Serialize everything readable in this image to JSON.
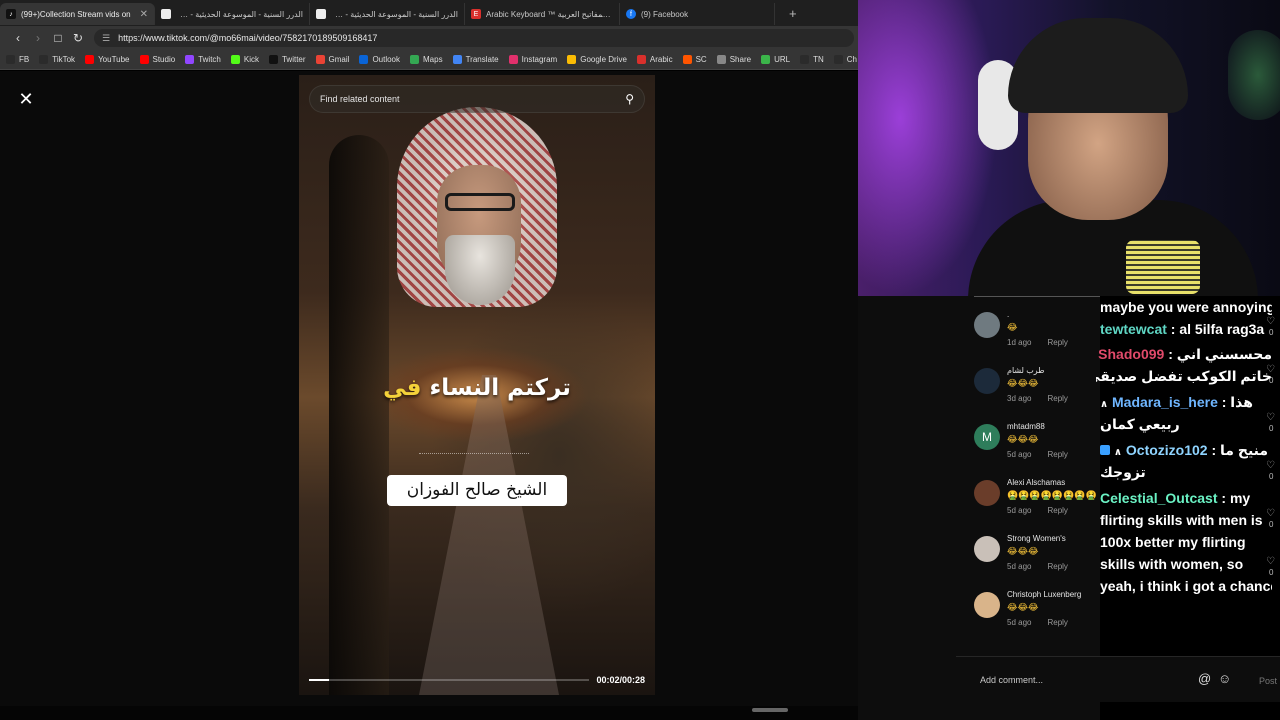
{
  "browser": {
    "tabs": [
      {
        "label": "(99+)Collection Stream vids on",
        "favicon": "tiktok-icon",
        "active": true
      },
      {
        "label": "الدرر السنية - الموسوعة الحديثية - شرو"
      },
      {
        "label": "الدرر السنية - الموسوعة الحديثية - شرو"
      },
      {
        "label": "Arabic Keyboard ™ لوحة المفاتيح العربية"
      },
      {
        "label": "(9) Facebook"
      }
    ],
    "new_tab": "+",
    "url": "https://www.tiktok.com/@mo66mai/video/7582170189509168417",
    "bookmarks": [
      {
        "label": "FB",
        "color": "#2b2b2b"
      },
      {
        "label": "TikTok",
        "color": "#2b2b2b"
      },
      {
        "label": "YouTube",
        "color": "#ff0000"
      },
      {
        "label": "Studio",
        "color": "#ff0000"
      },
      {
        "label": "Twitch",
        "color": "#9146ff"
      },
      {
        "label": "Kick",
        "color": "#53fc18"
      },
      {
        "label": "Twitter",
        "color": "#111111"
      },
      {
        "label": "Gmail",
        "color": "#ea4335"
      },
      {
        "label": "Outlook",
        "color": "#0a64d6"
      },
      {
        "label": "Maps",
        "color": "#34a853"
      },
      {
        "label": "Translate",
        "color": "#4285f4"
      },
      {
        "label": "Instagram",
        "color": "#e1306c"
      },
      {
        "label": "Google Drive",
        "color": "#fbbc04"
      },
      {
        "label": "Arabic",
        "color": "#d9302c"
      },
      {
        "label": "SC",
        "color": "#ff5500"
      },
      {
        "label": "Share",
        "color": "#888888"
      },
      {
        "label": "URL",
        "color": "#3bb54a"
      },
      {
        "label": "TN",
        "color": "#2b2b2b"
      },
      {
        "label": "Ch",
        "color": "#2b2b2b"
      }
    ]
  },
  "video": {
    "close": "✕",
    "search_placeholder": "Find related content",
    "caption_main": "تركتم النساء",
    "caption_highlight": "في",
    "caption_box": "الشيخ صالح الفوزان",
    "timecode": "00:02/00:28",
    "progress": 0.07
  },
  "comments": [
    {
      "name": ".",
      "emoji": "😂",
      "time": "1d ago",
      "reply": "Reply",
      "avatar_color": "#6f7a80"
    },
    {
      "name": "طرب لشام",
      "emoji": "😂😂😂",
      "time": "3d ago",
      "reply": "Reply",
      "avatar_color": "#1c2a3a"
    },
    {
      "name": "mhtadm88",
      "emoji": "😂😂😂",
      "time": "5d ago",
      "reply": "Reply",
      "avatar_color": "#2e7d5b",
      "avatar_letter": "M"
    },
    {
      "name": "Alexi Alschamas",
      "emoji": "🤮🤮🤮🤮🤮🤮🤮🤮",
      "time": "5d ago",
      "reply": "Reply",
      "avatar_color": "#6a3d2a"
    },
    {
      "name": "Strong Women's",
      "emoji": "😂😂😂",
      "time": "5d ago",
      "reply": "Reply",
      "avatar_color": "#c9c0b8"
    },
    {
      "name": "Christoph Luxenberg",
      "emoji": "😂😂😂",
      "time": "5d ago",
      "reply": "Reply",
      "avatar_color": "#d9b48a"
    }
  ],
  "like_counts": [
    "0",
    "0",
    "0",
    "0",
    "0",
    "0"
  ],
  "chat": {
    "l1": "maybe you were annoying",
    "l2_user": "tewtewcat",
    "l2_msg": " : al 5ilfa rag3a",
    "l3_user": "Shado099",
    "l3_msg": "محسسني اني : ",
    "l4": "خاتم الكوكب تفضل صديقي اسأل 🙂",
    "l5_user": "Madara_is_here",
    "l5_msg": "هذا : ",
    "l6": "ربيعي كمان",
    "l7_user": "Octozizo102",
    "l7_msg": "منيح ما : ",
    "l8": "تزوجك",
    "l9_user": "Celestial_Outcast",
    "l9_msg": " : my",
    "l10": "flirting skills with men is",
    "l11": "100x better my flirting",
    "l12": "skills with women, so",
    "l13": "yeah, i think i got a chance",
    "badge": "∧"
  },
  "comment_input": {
    "placeholder": "Add comment...",
    "at": "@",
    "emoji": "☺",
    "post": "Post"
  }
}
